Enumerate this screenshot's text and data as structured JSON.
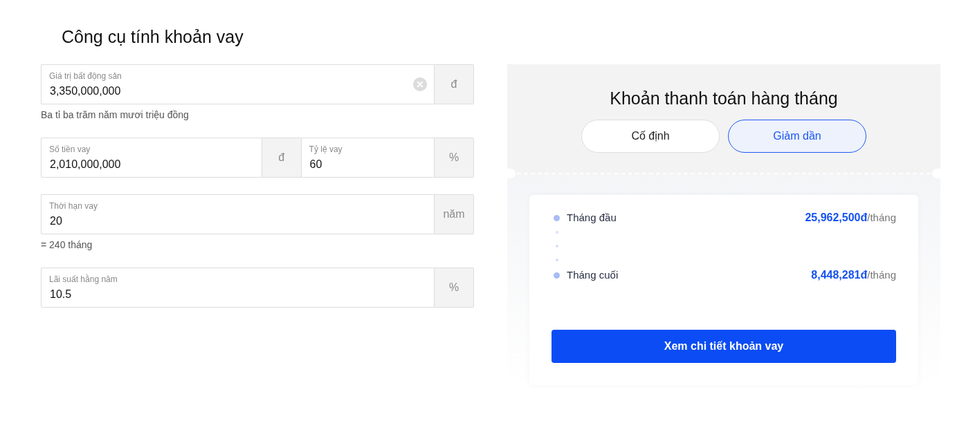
{
  "title": "Công cụ tính khoản vay",
  "form": {
    "rows": [
      {
        "fields": [
          {
            "label": "Giá trị bất động sản",
            "value": "3,350,000,000",
            "unit": "đ",
            "clearable": true
          }
        ],
        "note": "Ba tỉ ba trăm năm mươi triệu đồng"
      },
      {
        "fields": [
          {
            "label": "Số tiền vay",
            "value": "2,010,000,000",
            "unit": "đ",
            "clearable": false
          },
          {
            "label": "Tỷ lệ vay",
            "value": "60",
            "unit": "%",
            "clearable": false
          }
        ]
      },
      {
        "fields": [
          {
            "label": "Thời hạn vay",
            "value": "20",
            "unit": "năm",
            "clearable": false
          }
        ],
        "note": "= 240 tháng"
      },
      {
        "fields": [
          {
            "label": "Lãi suất hằng năm",
            "value": "10.5",
            "unit": "%",
            "clearable": false
          }
        ]
      }
    ]
  },
  "payment": {
    "title": "Khoản thanh toán hàng tháng",
    "modes": [
      {
        "label": "Cố định",
        "selected": false
      },
      {
        "label": "Giảm dần",
        "selected": true
      }
    ],
    "schedule": [
      {
        "label": "Tháng đầu",
        "amount": "25,962,500đ",
        "per": "/tháng"
      },
      {
        "label": "Tháng cuối",
        "amount": "8,448,281đ",
        "per": "/tháng"
      }
    ],
    "button": "Xem chi tiết khoản vay"
  }
}
